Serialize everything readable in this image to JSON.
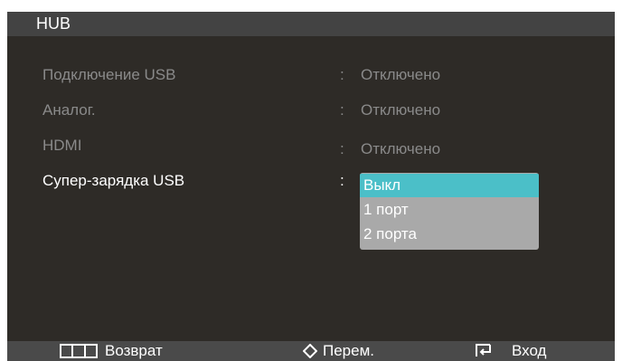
{
  "window": {
    "title": "HUB"
  },
  "menu": {
    "items": [
      {
        "label": "Подключение USB",
        "value": "Отключено"
      },
      {
        "label": "Аналог.",
        "value": "Отключено"
      },
      {
        "label": "HDMI",
        "value": "Отключено"
      },
      {
        "label": "Супер-зарядка USB",
        "value": ""
      }
    ],
    "separator": ":"
  },
  "dropdown": {
    "options": [
      "Выкл",
      "1 порт",
      "2 порта"
    ],
    "selected": "Выкл"
  },
  "footer": {
    "back_label": "Возврат",
    "move_label": "Перем.",
    "enter_label": "Вход"
  },
  "colors": {
    "background": "#2e2b27",
    "title_bar": "#434343",
    "selection": "#4bbfc8",
    "dropdown": "#a9a9a9",
    "dim_text": "#8a8a8a"
  }
}
